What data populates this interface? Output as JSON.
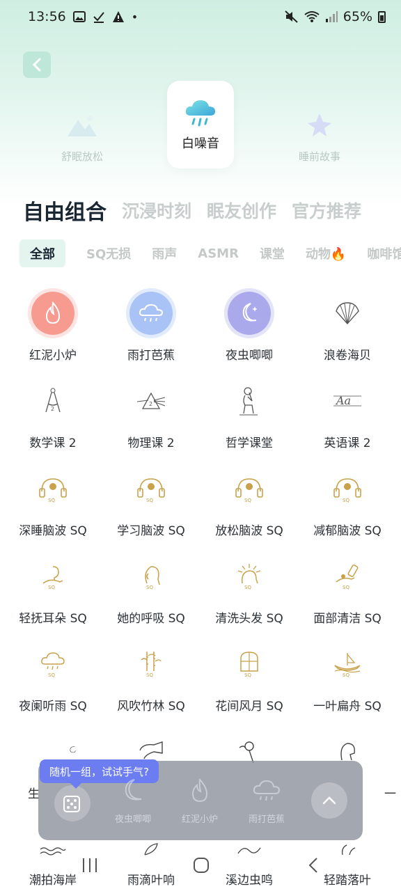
{
  "status": {
    "time": "13:56",
    "battery": "65%"
  },
  "header": {
    "modes": [
      {
        "label": "舒眠放松",
        "icon": "mountain-icon"
      },
      {
        "label": "白噪音",
        "icon": "rain-cloud-icon"
      },
      {
        "label": "睡前故事",
        "icon": "star-icon"
      }
    ]
  },
  "categories": [
    "自由组合",
    "沉浸时刻",
    "眠友创作",
    "官方推荐"
  ],
  "chips": [
    "全部",
    "SQ无损",
    "雨声",
    "ASMR",
    "课堂",
    "动物🔥",
    "咖啡馆"
  ],
  "sounds": [
    {
      "label": "红泥小炉",
      "icon": "fire-icon"
    },
    {
      "label": "雨打芭蕉",
      "icon": "rain-cloud-icon"
    },
    {
      "label": "夜虫唧唧",
      "icon": "moon-icon"
    },
    {
      "label": "浪卷海贝",
      "icon": "shell-icon"
    },
    {
      "label": "数学课 2",
      "icon": "compass-icon"
    },
    {
      "label": "物理课 2",
      "icon": "prism-icon"
    },
    {
      "label": "哲学课堂",
      "icon": "thinker-icon"
    },
    {
      "label": "英语课 2",
      "icon": "letters-icon"
    },
    {
      "label": "深睡脑波 SQ",
      "icon": "headphones-icon"
    },
    {
      "label": "学习脑波 SQ",
      "icon": "headphones-icon"
    },
    {
      "label": "放松脑波 SQ",
      "icon": "headphones-icon"
    },
    {
      "label": "减郁脑波 SQ",
      "icon": "headphones-icon"
    },
    {
      "label": "轻抚耳朵 SQ",
      "icon": "ear-hand-icon"
    },
    {
      "label": "她的呼吸 SQ",
      "icon": "face-icon"
    },
    {
      "label": "清洗头发 SQ",
      "icon": "hair-wash-icon"
    },
    {
      "label": "面部清洁 SQ",
      "icon": "face-clean-icon"
    },
    {
      "label": "夜阑听雨 SQ",
      "icon": "rain-cloud-icon"
    },
    {
      "label": "风吹竹林 SQ",
      "icon": "bamboo-icon"
    },
    {
      "label": "花间风月 SQ",
      "icon": "window-icon"
    },
    {
      "label": "一叶扁舟 SQ",
      "icon": "boat-icon"
    },
    {
      "label": "生",
      "icon": "swirl-icon"
    },
    {
      "label": "",
      "icon": "hairdryer-icon"
    },
    {
      "label": "",
      "icon": "flower-icon"
    },
    {
      "label": "一",
      "icon": "head-icon"
    },
    {
      "label": "潮拍海岸",
      "icon": "wave-icon"
    },
    {
      "label": "雨滴叶响",
      "icon": "leaf-icon"
    },
    {
      "label": "溪边虫鸣",
      "icon": "stream-icon"
    },
    {
      "label": "轻踏落叶",
      "icon": "footprint-icon"
    }
  ],
  "mixer": {
    "tip": "随机一组，试试手气?",
    "selected": [
      "夜虫唧唧",
      "红泥小炉",
      "雨打芭蕉"
    ]
  },
  "colors": {
    "accent": "#6b7df0",
    "active_chip_bg": "#e4f4ef",
    "gold": "#c9a14a"
  }
}
